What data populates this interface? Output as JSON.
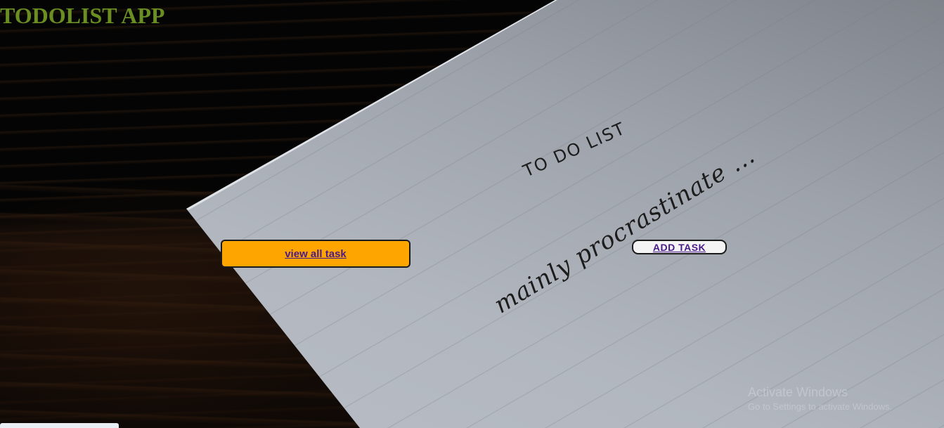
{
  "app": {
    "title": "TODOLIST APP"
  },
  "background_photo": {
    "paper_heading": "TO DO LIST",
    "paper_note": "mainly procrastinate ..."
  },
  "buttons": {
    "view_all_label": "view all task",
    "add_task_label": "ADD TASK"
  },
  "watermark": {
    "title": "Activate Windows",
    "subtitle": "Go to Settings to activate Windows."
  },
  "colors": {
    "title": "#6b8e23",
    "view_all_bg": "#ffa500",
    "link_text": "#4b1a8a",
    "add_task_bg": "#f4f4f4"
  }
}
